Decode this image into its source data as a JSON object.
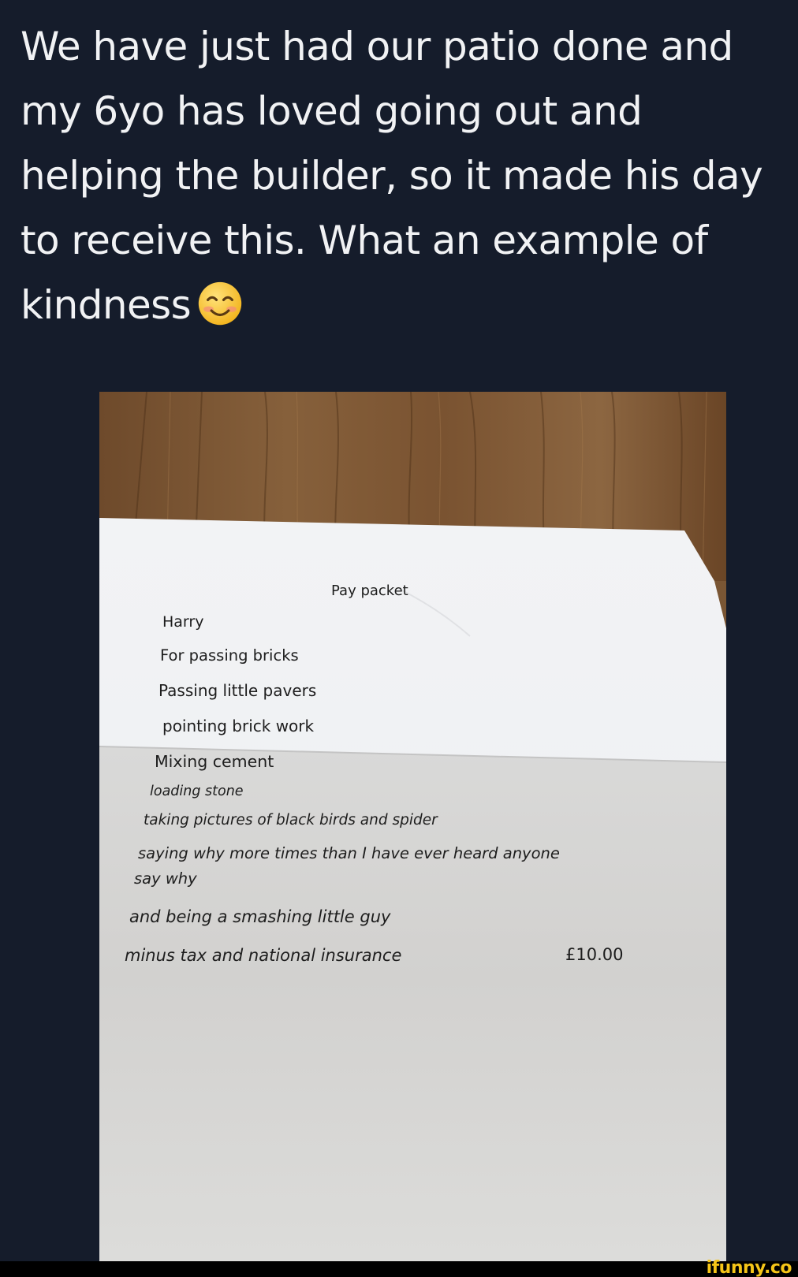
{
  "post": {
    "caption_lines": [
      "We have just had our patio done and",
      "my 6yo has loved going out and",
      "helping the builder, so it made his day",
      "to receive this. What an example of",
      "kindness"
    ],
    "caption_emoji": "smiling-face-icon"
  },
  "document": {
    "title": "Pay packet",
    "name": "Harry",
    "items": [
      "For passing bricks",
      "Passing little pavers",
      "pointing brick work",
      "Mixing cement",
      "loading stone",
      "taking pictures of black birds and spider",
      "saying why more times than I have ever heard anyone",
      "say why",
      "and being a smashing little guy"
    ],
    "total_label": "minus tax and national insurance",
    "total_amount": "£10.00"
  },
  "watermark": {
    "text": "ifunny.co"
  },
  "colors": {
    "background": "#151c2b",
    "caption_text": "#f1f2f4",
    "watermark": "#f5c518"
  }
}
